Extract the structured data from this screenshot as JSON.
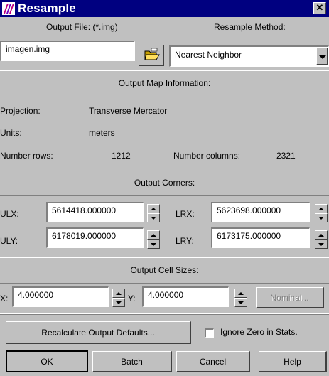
{
  "window": {
    "title": "Resample",
    "close_glyph": "✕",
    "icon": "app-logo-icon"
  },
  "output_file": {
    "label": "Output File: (*.img)",
    "value": "imagen.img",
    "browse_icon": "open-folder-icon"
  },
  "resample_method": {
    "label": "Resample Method:",
    "value": "Nearest Neighbor"
  },
  "map_info": {
    "header": "Output Map Information:",
    "projection_label": "Projection:",
    "projection_value": "Transverse Mercator",
    "units_label": "Units:",
    "units_value": "meters",
    "rows_label": "Number rows:",
    "rows_value": "1212",
    "cols_label": "Number columns:",
    "cols_value": "2321"
  },
  "corners": {
    "header": "Output Corners:",
    "ulx_label": "ULX:",
    "ulx_value": "5614418.000000",
    "lrx_label": "LRX:",
    "lrx_value": "5623698.000000",
    "uly_label": "ULY:",
    "uly_value": "6178019.000000",
    "lry_label": "LRY:",
    "lry_value": "6173175.000000"
  },
  "cell_sizes": {
    "header": "Output Cell Sizes:",
    "x_label": "X:",
    "x_value": "4.000000",
    "y_label": "Y:",
    "y_value": "4.000000",
    "nominal_label": "Nominal..."
  },
  "recalc_label": "Recalculate Output Defaults...",
  "ignore_zero": {
    "label": "Ignore Zero in Stats.",
    "checked": false
  },
  "buttons": {
    "ok": "OK",
    "batch": "Batch",
    "cancel": "Cancel",
    "help": "Help"
  },
  "colors": {
    "titlebar": "#000080",
    "face": "#c0c0c0"
  }
}
